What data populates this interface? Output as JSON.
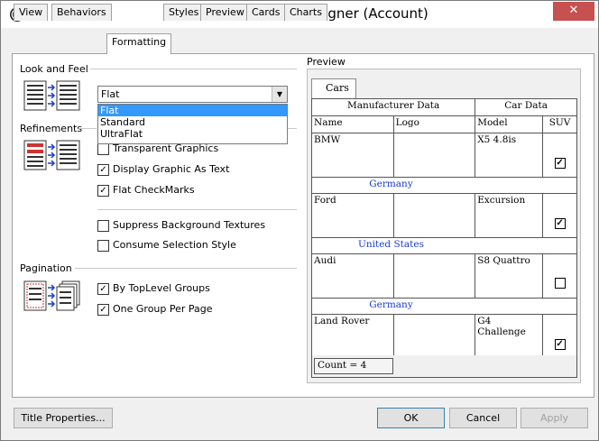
{
  "window": {
    "title": "OrgPassword Print Designer (Account)",
    "close_glyph": "✕"
  },
  "tabs": [
    "View",
    "Behaviors",
    "Formatting",
    "Styles",
    "Preview",
    "Cards",
    "Charts"
  ],
  "active_tab": "Formatting",
  "look_and_feel": {
    "label": "Look and Feel",
    "combo_value": "Flat",
    "options": [
      "Flat",
      "Standard",
      "UltraFlat"
    ]
  },
  "refinements": {
    "label": "Refinements",
    "checks": [
      {
        "label": "Transparent Graphics",
        "checked": false
      },
      {
        "label": "Display Graphic As Text",
        "checked": true
      },
      {
        "label": "Flat CheckMarks",
        "checked": true
      },
      {
        "label": "Suppress Background Textures",
        "checked": false
      },
      {
        "label": "Consume Selection Style",
        "checked": false
      }
    ]
  },
  "pagination": {
    "label": "Pagination",
    "checks": [
      {
        "label": "By TopLevel Groups",
        "checked": true
      },
      {
        "label": "One Group Per Page",
        "checked": true
      }
    ]
  },
  "preview": {
    "label": "Preview",
    "tab": "Cars",
    "band_headers": [
      "Manufacturer Data",
      "Car Data"
    ],
    "columns": [
      "Name",
      "Logo",
      "Model",
      "SUV"
    ],
    "rows": [
      {
        "name": "BMW",
        "model": "X5 4.8is",
        "suv": true,
        "group": "Germany"
      },
      {
        "name": "Ford",
        "model": "Excursion",
        "suv": true,
        "group": "United States"
      },
      {
        "name": "Audi",
        "model": "S8 Quattro",
        "suv": false,
        "group": "Germany"
      },
      {
        "name": "Land Rover",
        "model": "G4 Challenge",
        "suv": true,
        "group": ""
      }
    ],
    "count": "Count = 4"
  },
  "buttons": {
    "title_properties": "Title Properties...",
    "ok": "OK",
    "cancel": "Cancel",
    "apply": "Apply"
  },
  "colors": {
    "selection": "#3399ff",
    "group_text": "#1a3ccf",
    "close_button": "#c75050"
  }
}
